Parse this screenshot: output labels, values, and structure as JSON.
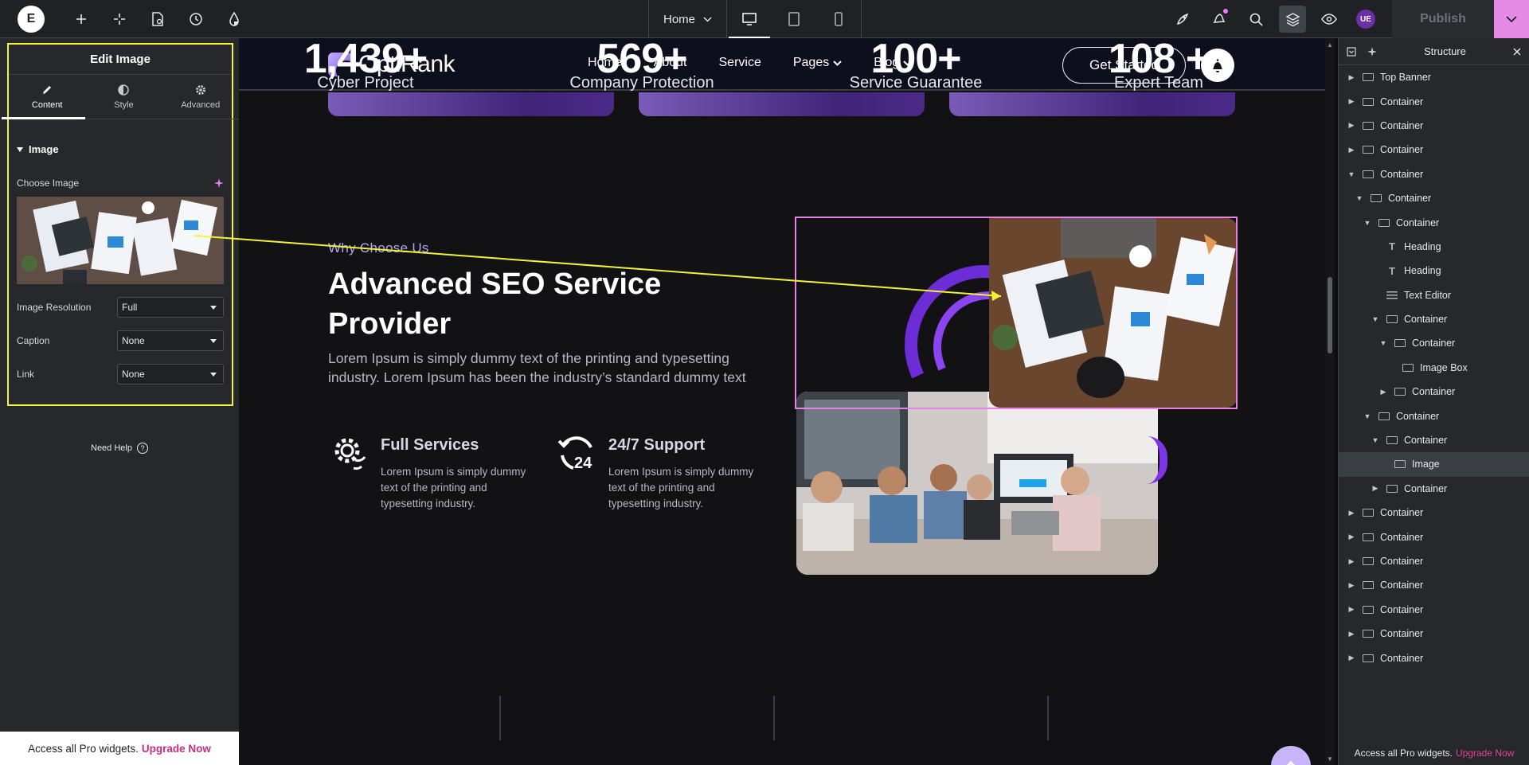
{
  "topbar": {
    "logo_text": "E",
    "page_name": "Home",
    "publish_label": "Publish",
    "avatar_initials": "UE",
    "left_icons": [
      "plus-icon",
      "elements-icon",
      "page-settings-icon",
      "history-icon",
      "color-drop-icon"
    ],
    "devices": [
      "desktop-icon",
      "tablet-icon",
      "mobile-icon"
    ],
    "right_icons": [
      "rocket-icon",
      "notifications-icon",
      "search-icon",
      "layers-icon",
      "preview-eye-icon"
    ]
  },
  "left_panel": {
    "title": "Edit Image",
    "tabs": [
      {
        "label": "Content",
        "icon": "pencil-icon",
        "active": true
      },
      {
        "label": "Style",
        "icon": "half-circle-icon",
        "active": false
      },
      {
        "label": "Advanced",
        "icon": "gear-icon",
        "active": false
      }
    ],
    "section": "Image",
    "choose_image_label": "Choose Image",
    "controls": [
      {
        "label": "Image Resolution",
        "value": "Full"
      },
      {
        "label": "Caption",
        "value": "None"
      },
      {
        "label": "Link",
        "value": "None"
      }
    ],
    "need_help": "Need Help",
    "pro_banner": {
      "text": "Access all Pro widgets.",
      "link": "Upgrade Now"
    }
  },
  "site": {
    "logo": "OptiRank",
    "nav": [
      {
        "label": "Home",
        "dropdown": false
      },
      {
        "label": "About",
        "dropdown": false
      },
      {
        "label": "Service",
        "dropdown": false
      },
      {
        "label": "Pages",
        "dropdown": true
      },
      {
        "label": "Blog",
        "dropdown": true
      }
    ],
    "cta": "Get Started",
    "why_label": "Why Choose Us",
    "headline": "Advanced SEO Service Provider",
    "body": "Lorem Ipsum is simply dummy text of the printing and typesetting industry. Lorem Ipsum has been the industry’s standard dummy text",
    "features": [
      {
        "title": "Full Services",
        "text": "Lorem Ipsum is simply dummy text of the printing and typesetting industry.",
        "icon": "gear-refresh-icon"
      },
      {
        "title": "24/7 Support",
        "text": "Lorem Ipsum is simply dummy text of the printing and typesetting industry.",
        "icon": "support-24-icon"
      }
    ],
    "stats": [
      {
        "number": "1,439+",
        "label": "Cyber Project"
      },
      {
        "number": "569+",
        "label": "Company Protection"
      },
      {
        "number": "100+",
        "label": "Service Guarantee"
      },
      {
        "number": "108 +",
        "label": "Expert Team"
      }
    ]
  },
  "structure": {
    "title": "Structure",
    "items": [
      {
        "label": "Top Banner",
        "depth": 0,
        "toggle": "collapsed",
        "icon": "container"
      },
      {
        "label": "Container",
        "depth": 0,
        "toggle": "collapsed",
        "icon": "container"
      },
      {
        "label": "Container",
        "depth": 0,
        "toggle": "collapsed",
        "icon": "container"
      },
      {
        "label": "Container",
        "depth": 0,
        "toggle": "collapsed",
        "icon": "container"
      },
      {
        "label": "Container",
        "depth": 0,
        "toggle": "expanded",
        "icon": "container"
      },
      {
        "label": "Container",
        "depth": 1,
        "toggle": "expanded",
        "icon": "container"
      },
      {
        "label": "Container",
        "depth": 2,
        "toggle": "expanded",
        "icon": "container"
      },
      {
        "label": "Heading",
        "depth": 3,
        "toggle": "none",
        "icon": "heading"
      },
      {
        "label": "Heading",
        "depth": 3,
        "toggle": "none",
        "icon": "heading"
      },
      {
        "label": "Text Editor",
        "depth": 3,
        "toggle": "none",
        "icon": "text"
      },
      {
        "label": "Container",
        "depth": 3,
        "toggle": "expanded",
        "icon": "container"
      },
      {
        "label": "Container",
        "depth": 4,
        "toggle": "expanded",
        "icon": "container"
      },
      {
        "label": "Image Box",
        "depth": 5,
        "toggle": "none",
        "icon": "imagebox"
      },
      {
        "label": "Container",
        "depth": 4,
        "toggle": "collapsed",
        "icon": "container"
      },
      {
        "label": "Container",
        "depth": 2,
        "toggle": "expanded",
        "icon": "container"
      },
      {
        "label": "Container",
        "depth": 3,
        "toggle": "expanded",
        "icon": "container"
      },
      {
        "label": "Image",
        "depth": 4,
        "toggle": "none",
        "icon": "image",
        "selected": true
      },
      {
        "label": "Container",
        "depth": 3,
        "toggle": "collapsed",
        "icon": "container"
      },
      {
        "label": "Container",
        "depth": 0,
        "toggle": "collapsed",
        "icon": "container"
      },
      {
        "label": "Container",
        "depth": 0,
        "toggle": "collapsed",
        "icon": "container"
      },
      {
        "label": "Container",
        "depth": 0,
        "toggle": "collapsed",
        "icon": "container"
      },
      {
        "label": "Container",
        "depth": 0,
        "toggle": "collapsed",
        "icon": "container"
      },
      {
        "label": "Container",
        "depth": 0,
        "toggle": "collapsed",
        "icon": "container"
      },
      {
        "label": "Container",
        "depth": 0,
        "toggle": "collapsed",
        "icon": "container"
      },
      {
        "label": "Container",
        "depth": 0,
        "toggle": "collapsed",
        "icon": "container"
      }
    ],
    "pro_banner": {
      "text": "Access all Pro widgets.",
      "link": "Upgrade Now"
    }
  },
  "colors": {
    "accent_pink": "#e880e8",
    "highlight_yellow": "#f2f23a",
    "brand_purple": "#7b4dd8",
    "upgrade_link": "#c92d7f"
  }
}
